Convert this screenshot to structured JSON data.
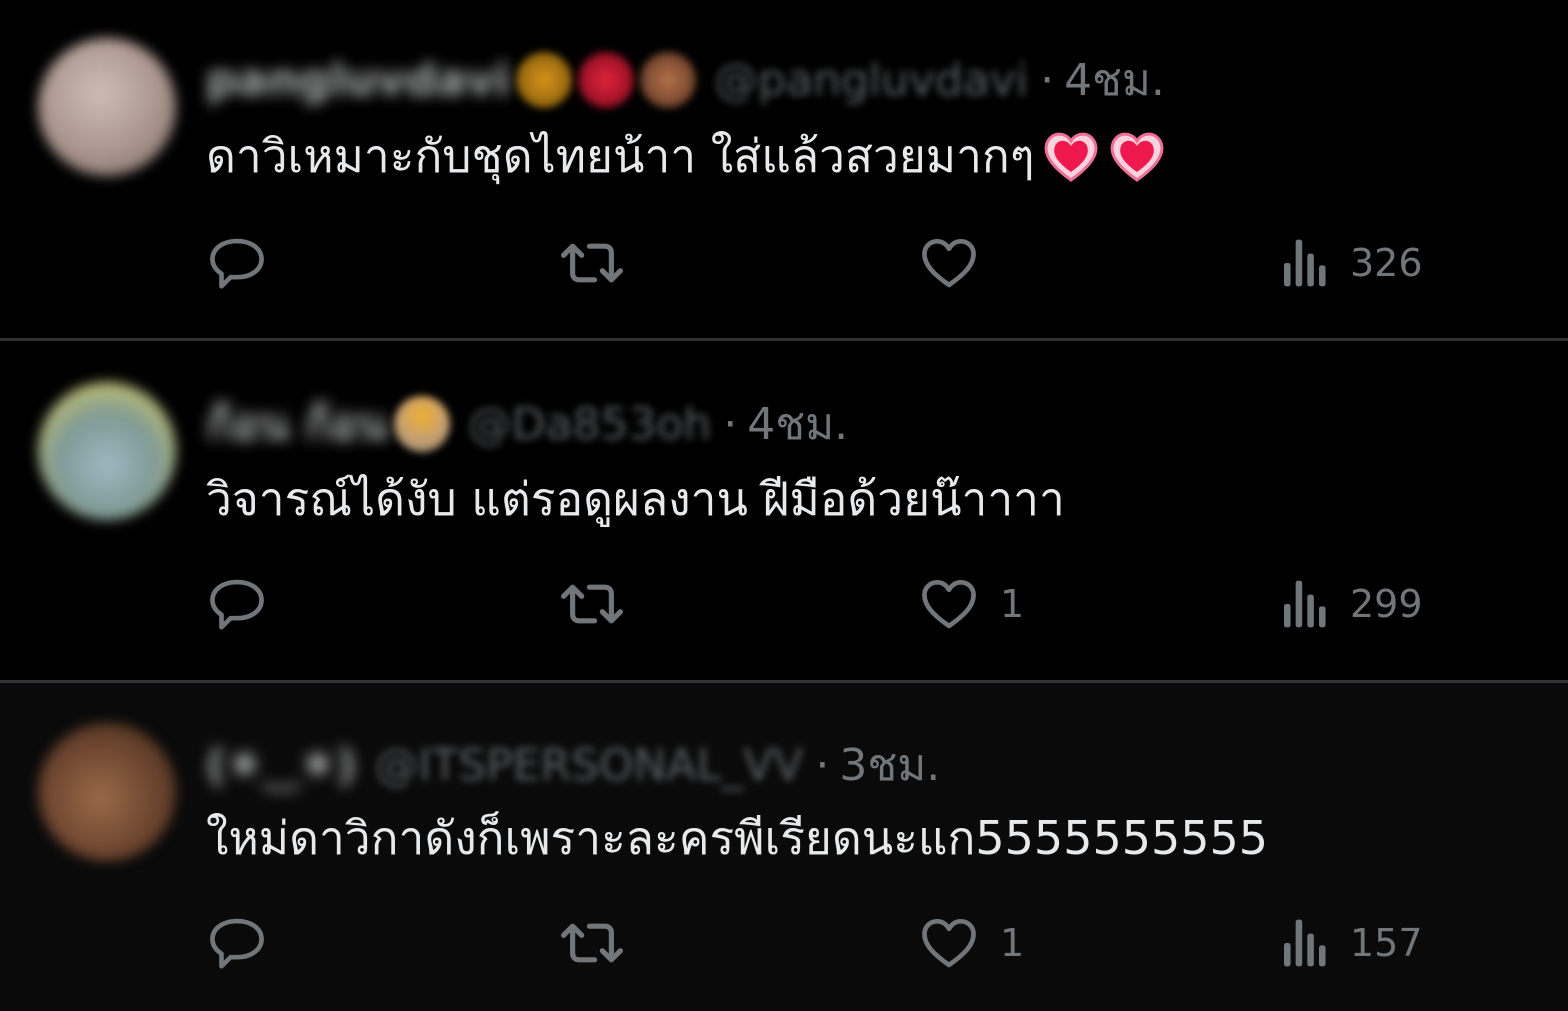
{
  "posts": [
    {
      "display_name": "pangluvdavi",
      "handle": "@pangluvdavi",
      "time": "4ชม.",
      "text": "ดาวิเหมาะกับชุดไทยน้าา ใส่แล้วสวยมากๆ",
      "text_emoji_icons": [
        "growing-heart-icon",
        "growing-heart-icon"
      ],
      "name_emoji_icons": [
        "sunflower-icon",
        "red-heart-icon",
        "squirrel-icon"
      ],
      "replies": "",
      "reposts": "",
      "likes": "",
      "views": "326"
    },
    {
      "display_name": "ก้อน ก้อน",
      "handle": "@Da853oh",
      "time": "4ชม.",
      "text": "วิจารณ์ได้งับ แต่รอดูผลงาน ฝีมือด้วยน๊าาาา",
      "name_emoji_icons": [
        "sun-behind-cloud-icon"
      ],
      "replies": "",
      "reposts": "",
      "likes": "1",
      "views": "299"
    },
    {
      "display_name": "(✷‿✷)",
      "handle": "@ITSPERSONAL_VV",
      "time": "3ชม.",
      "text": "ใหม่ดาวิกาดังก็เพราะละครพีเรียดนะแก5555555555",
      "replies": "",
      "reposts": "",
      "likes": "1",
      "views": "157"
    }
  ],
  "separator": "·",
  "colors": {
    "background": "#000000",
    "text": "#e7e9ea",
    "secondary": "#71767b",
    "divider": "#2f3336",
    "heart_emoji": "#f91880"
  }
}
